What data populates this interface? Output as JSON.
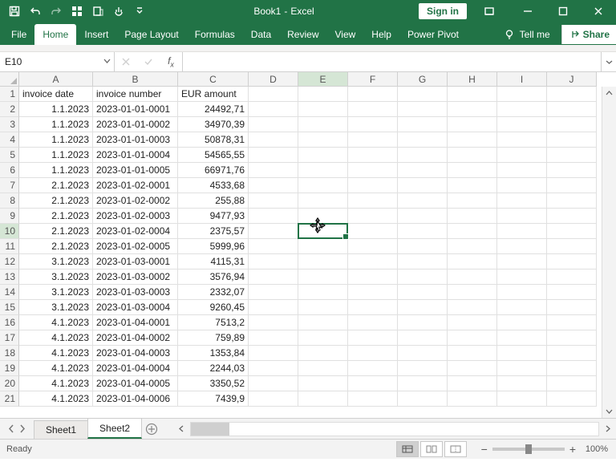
{
  "title": {
    "book": "Book1",
    "app": "Excel"
  },
  "signin": "Sign in",
  "tabs": [
    "File",
    "Home",
    "Insert",
    "Page Layout",
    "Formulas",
    "Data",
    "Review",
    "View",
    "Help",
    "Power Pivot"
  ],
  "active_tab": "Home",
  "tell_me": "Tell me",
  "share": "Share",
  "namebox": "E10",
  "formula": "",
  "columns": [
    "A",
    "B",
    "C",
    "D",
    "E",
    "F",
    "G",
    "H",
    "I",
    "J"
  ],
  "row_headers": [
    "1",
    "2",
    "3",
    "4",
    "5",
    "6",
    "7",
    "8",
    "9",
    "10",
    "11",
    "12",
    "13",
    "14",
    "15",
    "16",
    "17",
    "18",
    "19",
    "20",
    "21"
  ],
  "selected_cell": {
    "col": "E",
    "row": "10"
  },
  "headers": {
    "A": "invoice date",
    "B": "invoice number",
    "C": "EUR amount"
  },
  "data": [
    {
      "A": "1.1.2023",
      "B": "2023-01-01-0001",
      "C": "24492,71"
    },
    {
      "A": "1.1.2023",
      "B": "2023-01-01-0002",
      "C": "34970,39"
    },
    {
      "A": "1.1.2023",
      "B": "2023-01-01-0003",
      "C": "50878,31"
    },
    {
      "A": "1.1.2023",
      "B": "2023-01-01-0004",
      "C": "54565,55"
    },
    {
      "A": "1.1.2023",
      "B": "2023-01-01-0005",
      "C": "66971,76"
    },
    {
      "A": "2.1.2023",
      "B": "2023-01-02-0001",
      "C": "4533,68"
    },
    {
      "A": "2.1.2023",
      "B": "2023-01-02-0002",
      "C": "255,88"
    },
    {
      "A": "2.1.2023",
      "B": "2023-01-02-0003",
      "C": "9477,93"
    },
    {
      "A": "2.1.2023",
      "B": "2023-01-02-0004",
      "C": "2375,57"
    },
    {
      "A": "2.1.2023",
      "B": "2023-01-02-0005",
      "C": "5999,96"
    },
    {
      "A": "3.1.2023",
      "B": "2023-01-03-0001",
      "C": "4115,31"
    },
    {
      "A": "3.1.2023",
      "B": "2023-01-03-0002",
      "C": "3576,94"
    },
    {
      "A": "3.1.2023",
      "B": "2023-01-03-0003",
      "C": "2332,07"
    },
    {
      "A": "3.1.2023",
      "B": "2023-01-03-0004",
      "C": "9260,45"
    },
    {
      "A": "4.1.2023",
      "B": "2023-01-04-0001",
      "C": "7513,2"
    },
    {
      "A": "4.1.2023",
      "B": "2023-01-04-0002",
      "C": "759,89"
    },
    {
      "A": "4.1.2023",
      "B": "2023-01-04-0003",
      "C": "1353,84"
    },
    {
      "A": "4.1.2023",
      "B": "2023-01-04-0004",
      "C": "2244,03"
    },
    {
      "A": "4.1.2023",
      "B": "2023-01-04-0005",
      "C": "3350,52"
    },
    {
      "A": "4.1.2023",
      "B": "2023-01-04-0006",
      "C": "7439,9"
    }
  ],
  "sheets": [
    "Sheet1",
    "Sheet2"
  ],
  "active_sheet": "Sheet2",
  "status": "Ready",
  "zoom": "100%"
}
